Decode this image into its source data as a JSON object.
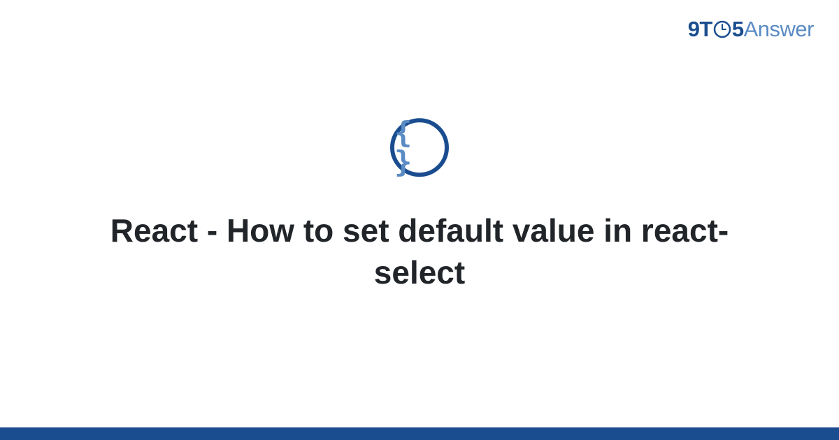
{
  "logo": {
    "part1": "9T",
    "part2": "5",
    "part3": "Answer"
  },
  "icon": {
    "name": "code-braces-icon",
    "glyph": "{ }"
  },
  "title": "React - How to set default value in react-select",
  "colors": {
    "primary": "#1a4d8f",
    "secondary": "#5a8bc4",
    "text": "#212529"
  }
}
